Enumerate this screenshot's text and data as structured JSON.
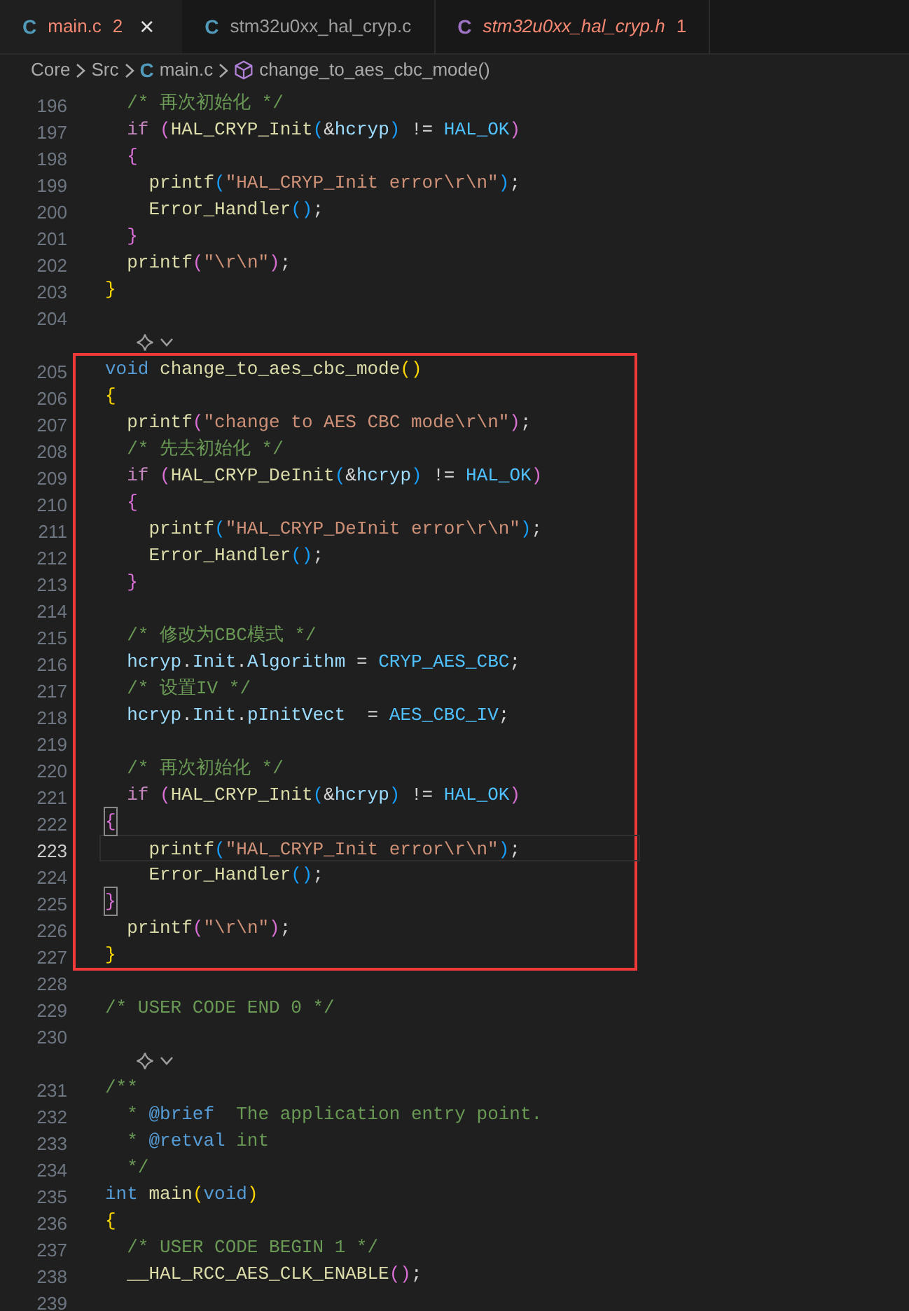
{
  "tabs": [
    {
      "icon_text": "C",
      "color": "#519aba",
      "label": "main.c",
      "badge": "2",
      "selected": true,
      "preview": false,
      "error": true,
      "close": "×"
    },
    {
      "icon_text": "C",
      "color": "#519aba",
      "label": "stm32u0xx_hal_cryp.c",
      "selected": false,
      "preview": false,
      "error": false
    },
    {
      "icon_text": "C",
      "color": "#a074c4",
      "label": "stm32u0xx_hal_cryp.h",
      "badge": "1",
      "selected": false,
      "preview": true,
      "error": true
    }
  ],
  "breadcrumbs": [
    {
      "kind": "folder",
      "label": "Core"
    },
    {
      "kind": "folder",
      "label": "Src"
    },
    {
      "kind": "file",
      "icon_text": "C",
      "label": "main.c"
    },
    {
      "kind": "symbol",
      "label": "change_to_aes_cbc_mode()"
    }
  ],
  "sections": [
    {
      "kind": "plain",
      "lines": [
        {
          "kind": "code",
          "number": "196",
          "current": false,
          "tokens": [
            {
              "kind": "comment",
              "text": "  /* 再次初始化 */"
            }
          ]
        },
        {
          "kind": "code",
          "number": "197",
          "current": false,
          "tokens": [
            {
              "kind": "control",
              "text": "  if "
            },
            {
              "kind": "b2",
              "text": "("
            },
            {
              "kind": "func",
              "text": "HAL_CRYP_Init"
            },
            {
              "kind": "b3",
              "text": "("
            },
            {
              "kind": "plain",
              "text": "&"
            },
            {
              "kind": "var",
              "text": "hcryp"
            },
            {
              "kind": "b3",
              "text": ")"
            },
            {
              "kind": "plain",
              "text": " != "
            },
            {
              "kind": "macro",
              "text": "HAL_OK"
            },
            {
              "kind": "b2",
              "text": ")"
            }
          ]
        },
        {
          "kind": "code",
          "number": "198",
          "current": false,
          "tokens": [
            {
              "kind": "b2",
              "text": "  {"
            }
          ]
        },
        {
          "kind": "code",
          "number": "199",
          "current": false,
          "tokens": [
            {
              "kind": "func",
              "text": "    printf"
            },
            {
              "kind": "b3",
              "text": "("
            },
            {
              "kind": "string",
              "text": "\"HAL_CRYP_Init error\\r\\n\""
            },
            {
              "kind": "b3",
              "text": ")"
            },
            {
              "kind": "plain",
              "text": ";"
            }
          ]
        },
        {
          "kind": "code",
          "number": "200",
          "current": false,
          "tokens": [
            {
              "kind": "func",
              "text": "    Error_Handler"
            },
            {
              "kind": "b3",
              "text": "()"
            },
            {
              "kind": "plain",
              "text": ";"
            }
          ]
        },
        {
          "kind": "code",
          "number": "201",
          "current": false,
          "tokens": [
            {
              "kind": "b2",
              "text": "  }"
            }
          ]
        },
        {
          "kind": "code",
          "number": "202",
          "current": false,
          "tokens": [
            {
              "kind": "func",
              "text": "  printf"
            },
            {
              "kind": "b2",
              "text": "("
            },
            {
              "kind": "string",
              "text": "\"\\r\\n\""
            },
            {
              "kind": "b2",
              "text": ")"
            },
            {
              "kind": "plain",
              "text": ";"
            }
          ]
        },
        {
          "kind": "code",
          "number": "203",
          "current": false,
          "tokens": [
            {
              "kind": "b1",
              "text": "}"
            }
          ]
        },
        {
          "kind": "code",
          "number": "204",
          "current": false
        },
        {
          "kind": "codelens"
        }
      ]
    },
    {
      "kind": "boxed",
      "lines": [
        {
          "kind": "code",
          "number": "205",
          "current": false,
          "tokens": [
            {
              "kind": "keyword",
              "text": "void "
            },
            {
              "kind": "func",
              "text": "change_to_aes_cbc_mode"
            },
            {
              "kind": "b1",
              "text": "()"
            }
          ]
        },
        {
          "kind": "code",
          "number": "206",
          "current": false,
          "tokens": [
            {
              "kind": "b1",
              "text": "{"
            }
          ]
        },
        {
          "kind": "code",
          "number": "207",
          "current": false,
          "tokens": [
            {
              "kind": "func",
              "text": "  printf"
            },
            {
              "kind": "b2",
              "text": "("
            },
            {
              "kind": "string",
              "text": "\"change to AES CBC mode\\r\\n\""
            },
            {
              "kind": "b2",
              "text": ")"
            },
            {
              "kind": "plain",
              "text": ";"
            }
          ]
        },
        {
          "kind": "code",
          "number": "208",
          "current": false,
          "tokens": [
            {
              "kind": "comment",
              "text": "  /* 先去初始化 */"
            }
          ]
        },
        {
          "kind": "code",
          "number": "209",
          "current": false,
          "tokens": [
            {
              "kind": "control",
              "text": "  if "
            },
            {
              "kind": "b2",
              "text": "("
            },
            {
              "kind": "func",
              "text": "HAL_CRYP_DeInit"
            },
            {
              "kind": "b3",
              "text": "("
            },
            {
              "kind": "plain",
              "text": "&"
            },
            {
              "kind": "var",
              "text": "hcryp"
            },
            {
              "kind": "b3",
              "text": ")"
            },
            {
              "kind": "plain",
              "text": " != "
            },
            {
              "kind": "macro",
              "text": "HAL_OK"
            },
            {
              "kind": "b2",
              "text": ")"
            }
          ]
        },
        {
          "kind": "code",
          "number": "210",
          "current": false,
          "tokens": [
            {
              "kind": "b2",
              "text": "  {"
            }
          ]
        },
        {
          "kind": "code",
          "number": "211",
          "current": false,
          "tokens": [
            {
              "kind": "func",
              "text": "    printf"
            },
            {
              "kind": "b3",
              "text": "("
            },
            {
              "kind": "string",
              "text": "\"HAL_CRYP_DeInit error\\r\\n\""
            },
            {
              "kind": "b3",
              "text": ")"
            },
            {
              "kind": "plain",
              "text": ";"
            }
          ]
        },
        {
          "kind": "code",
          "number": "212",
          "current": false,
          "tokens": [
            {
              "kind": "func",
              "text": "    Error_Handler"
            },
            {
              "kind": "b3",
              "text": "()"
            },
            {
              "kind": "plain",
              "text": ";"
            }
          ]
        },
        {
          "kind": "code",
          "number": "213",
          "current": false,
          "tokens": [
            {
              "kind": "b2",
              "text": "  }"
            }
          ]
        },
        {
          "kind": "code",
          "number": "214",
          "current": false
        },
        {
          "kind": "code",
          "number": "215",
          "current": false,
          "tokens": [
            {
              "kind": "comment",
              "text": "  /* 修改为CBC模式 */"
            }
          ]
        },
        {
          "kind": "code",
          "number": "216",
          "current": false,
          "tokens": [
            {
              "kind": "var",
              "text": "  hcryp"
            },
            {
              "kind": "plain",
              "text": "."
            },
            {
              "kind": "var",
              "text": "Init"
            },
            {
              "kind": "plain",
              "text": "."
            },
            {
              "kind": "var",
              "text": "Algorithm"
            },
            {
              "kind": "plain",
              "text": " = "
            },
            {
              "kind": "macro",
              "text": "CRYP_AES_CBC"
            },
            {
              "kind": "plain",
              "text": ";"
            }
          ]
        },
        {
          "kind": "code",
          "number": "217",
          "current": false,
          "tokens": [
            {
              "kind": "comment",
              "text": "  /* 设置IV */"
            }
          ]
        },
        {
          "kind": "code",
          "number": "218",
          "current": false,
          "tokens": [
            {
              "kind": "var",
              "text": "  hcryp"
            },
            {
              "kind": "plain",
              "text": "."
            },
            {
              "kind": "var",
              "text": "Init"
            },
            {
              "kind": "plain",
              "text": "."
            },
            {
              "kind": "var",
              "text": "pInitVect"
            },
            {
              "kind": "plain",
              "text": "  = "
            },
            {
              "kind": "macro",
              "text": "AES_CBC_IV"
            },
            {
              "kind": "plain",
              "text": ";"
            }
          ]
        },
        {
          "kind": "code",
          "number": "219",
          "current": false
        },
        {
          "kind": "code",
          "number": "220",
          "current": false,
          "tokens": [
            {
              "kind": "comment",
              "text": "  /* 再次初始化 */"
            }
          ]
        },
        {
          "kind": "code",
          "number": "221",
          "current": false,
          "tokens": [
            {
              "kind": "control",
              "text": "  if "
            },
            {
              "kind": "b2",
              "text": "("
            },
            {
              "kind": "func",
              "text": "HAL_CRYP_Init"
            },
            {
              "kind": "b3",
              "text": "("
            },
            {
              "kind": "plain",
              "text": "&"
            },
            {
              "kind": "var",
              "text": "hcryp"
            },
            {
              "kind": "b3",
              "text": ")"
            },
            {
              "kind": "plain",
              "text": " != "
            },
            {
              "kind": "macro",
              "text": "HAL_OK"
            },
            {
              "kind": "b2",
              "text": ")"
            }
          ]
        },
        {
          "kind": "code",
          "number": "222",
          "current": false,
          "tokens": [
            {
              "kind": "matched",
              "text": "{"
            }
          ]
        },
        {
          "kind": "code",
          "number": "223",
          "current": true,
          "tokens": [
            {
              "kind": "func",
              "text": "    printf"
            },
            {
              "kind": "b3",
              "text": "("
            },
            {
              "kind": "string",
              "text": "\"HAL_CRYP_Init error\\r\\n\""
            },
            {
              "kind": "b3",
              "text": ")"
            },
            {
              "kind": "plain",
              "text": ";"
            }
          ]
        },
        {
          "kind": "code",
          "number": "224",
          "current": false,
          "tokens": [
            {
              "kind": "func",
              "text": "    Error_Handler"
            },
            {
              "kind": "b3",
              "text": "()"
            },
            {
              "kind": "plain",
              "text": ";"
            }
          ]
        },
        {
          "kind": "code",
          "number": "225",
          "current": false,
          "tokens": [
            {
              "kind": "matched",
              "text": "}"
            }
          ]
        },
        {
          "kind": "code",
          "number": "226",
          "current": false,
          "tokens": [
            {
              "kind": "func",
              "text": "  printf"
            },
            {
              "kind": "b2",
              "text": "("
            },
            {
              "kind": "string",
              "text": "\"\\r\\n\""
            },
            {
              "kind": "b2",
              "text": ")"
            },
            {
              "kind": "plain",
              "text": ";"
            }
          ]
        },
        {
          "kind": "code",
          "number": "227",
          "current": false,
          "tokens": [
            {
              "kind": "b1",
              "text": "}"
            }
          ]
        }
      ]
    },
    {
      "kind": "plain",
      "lines": [
        {
          "kind": "code",
          "number": "228",
          "current": false
        },
        {
          "kind": "code",
          "number": "229",
          "current": false,
          "tokens": [
            {
              "kind": "comment",
              "text": "/* USER CODE END 0 */"
            }
          ]
        },
        {
          "kind": "code",
          "number": "230",
          "current": false
        },
        {
          "kind": "codelens"
        },
        {
          "kind": "code",
          "number": "231",
          "current": false,
          "tokens": [
            {
              "kind": "comment",
              "text": "/**"
            }
          ]
        },
        {
          "kind": "code",
          "number": "232",
          "current": false,
          "tokens": [
            {
              "kind": "comment",
              "text": "  * "
            },
            {
              "kind": "doctag",
              "text": "@brief"
            },
            {
              "kind": "comment",
              "text": "  The application entry point."
            }
          ]
        },
        {
          "kind": "code",
          "number": "233",
          "current": false,
          "tokens": [
            {
              "kind": "comment",
              "text": "  * "
            },
            {
              "kind": "doctag",
              "text": "@retval"
            },
            {
              "kind": "comment",
              "text": " int"
            }
          ]
        },
        {
          "kind": "code",
          "number": "234",
          "current": false,
          "tokens": [
            {
              "kind": "comment",
              "text": "  */"
            }
          ]
        },
        {
          "kind": "code",
          "number": "235",
          "current": false,
          "tokens": [
            {
              "kind": "keyword",
              "text": "int "
            },
            {
              "kind": "func",
              "text": "main"
            },
            {
              "kind": "b1",
              "text": "("
            },
            {
              "kind": "keyword",
              "text": "void"
            },
            {
              "kind": "b1",
              "text": ")"
            }
          ]
        },
        {
          "kind": "code",
          "number": "236",
          "current": false,
          "tokens": [
            {
              "kind": "b1",
              "text": "{"
            }
          ]
        },
        {
          "kind": "code",
          "number": "237",
          "current": false,
          "tokens": [
            {
              "kind": "comment",
              "text": "  /* USER CODE BEGIN 1 */"
            }
          ]
        },
        {
          "kind": "code",
          "number": "238",
          "current": false,
          "tokens": [
            {
              "kind": "func",
              "text": "  __HAL_RCC_AES_CLK_ENABLE"
            },
            {
              "kind": "b2",
              "text": "()"
            },
            {
              "kind": "plain",
              "text": ";"
            }
          ]
        },
        {
          "kind": "code",
          "number": "239",
          "current": false
        }
      ]
    }
  ]
}
